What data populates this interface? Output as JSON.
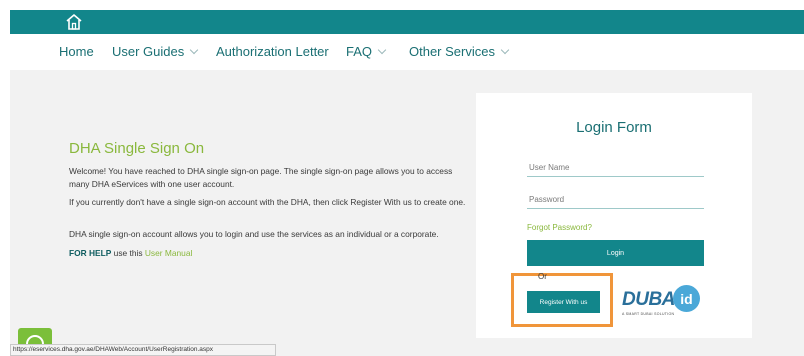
{
  "topbar": {
    "home_icon": "home-icon",
    "color": "#12868b"
  },
  "nav": {
    "items": [
      {
        "label": "Home",
        "has_dropdown": false
      },
      {
        "label": "User Guides",
        "has_dropdown": true
      },
      {
        "label": "Authorization Letter",
        "has_dropdown": false
      },
      {
        "label": "FAQ",
        "has_dropdown": true
      },
      {
        "label": "Other Services",
        "has_dropdown": true
      }
    ]
  },
  "sso": {
    "title": "DHA Single Sign On",
    "paragraphs": [
      "Welcome! You have reached to DHA single sign-on page. The single sign-on page allows you to access many DHA eServices with one user account.",
      "If you currently don't have a single sign-on account with the DHA, then click Register With us to create one.",
      "DHA single sign-on account allows you to login and use the services as an individual or a corporate."
    ],
    "help_prefix": "FOR HELP",
    "help_middle": " use this ",
    "help_link": "User Manual"
  },
  "login": {
    "title": "Login Form",
    "username_placeholder": "User Name",
    "password_placeholder": "Password",
    "forgot_label": "Forgot Password?",
    "login_button": "Login",
    "or_text": "Or",
    "register_button": "Register With us"
  },
  "dubai_logo": {
    "word": "DUBAI",
    "id": "id",
    "tagline": "A SMART DUBAI SOLUTION"
  },
  "status_bar": {
    "url": "https://eservices.dha.gov.ae/DHAWeb/Account/UserRegistration.aspx"
  },
  "colors": {
    "brand": "#12868b",
    "accent_green": "#8ab83d",
    "highlight": "#f0953a"
  }
}
